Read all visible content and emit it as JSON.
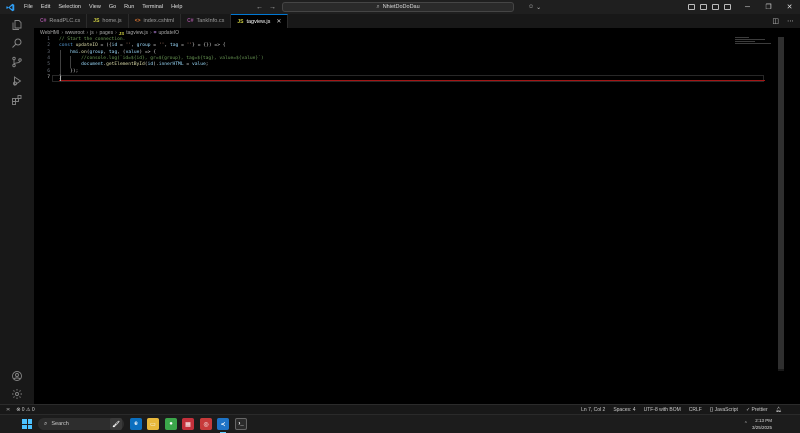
{
  "titlebar": {
    "menus": [
      "File",
      "Edit",
      "Selection",
      "View",
      "Go",
      "Run",
      "Terminal",
      "Help"
    ],
    "search_text": "NhietDoDoDau",
    "nav_back": "←",
    "nav_forward": "→"
  },
  "tabs": [
    {
      "icon": "C#",
      "icon_color": "#9b4f96",
      "label": "ReadPLC.cs",
      "active": false
    },
    {
      "icon": "JS",
      "icon_color": "#cbcb41",
      "label": "home.js",
      "active": false
    },
    {
      "icon": "<>",
      "icon_color": "#e37933",
      "label": "index.cshtml",
      "active": false
    },
    {
      "icon": "C#",
      "icon_color": "#9b4f96",
      "label": "TankInfo.cs",
      "active": false
    },
    {
      "icon": "JS",
      "icon_color": "#cbcb41",
      "label": "tagview.js",
      "active": true
    }
  ],
  "breadcrumb": {
    "parts": [
      "WebHMI",
      "wwwroot",
      "js",
      "pages"
    ],
    "file_icon": "JS",
    "file": "tagview.js",
    "symbol": "updateIO"
  },
  "editor": {
    "lines": [
      {
        "n": "1",
        "text": "// Start the connection."
      },
      {
        "n": "2",
        "text": "const updateIO = ({id = '', group = '', tag = ''} = {}) => {"
      },
      {
        "n": "3",
        "text": "    hmi.on(group, tag, (value) => {"
      },
      {
        "n": "4",
        "text": "        //console.log(`id=${id}, gr=${group}, tag=${tag}, value=${value}`)"
      },
      {
        "n": "5",
        "text": "        document.getElementById(id).innerHTML = value;"
      },
      {
        "n": "6",
        "text": "    });"
      },
      {
        "n": "7",
        "text": "}"
      }
    ]
  },
  "statusbar": {
    "remote": "≍",
    "problems": "⊗ 0 ⚠ 0",
    "position": "Ln 7, Col 2",
    "spaces": "Spaces: 4",
    "encoding": "UTF-8 with BOM",
    "eol": "CRLF",
    "language": "JavaScript",
    "prettier": "✓ Prettier"
  },
  "taskbar": {
    "search_placeholder": "Search",
    "time": "2:13 PM",
    "date": "3/25/2025"
  },
  "colors": {
    "accent": "#0078d4",
    "error_underline": "#a31515",
    "comment": "#6a9955",
    "keyword": "#569cd6"
  }
}
